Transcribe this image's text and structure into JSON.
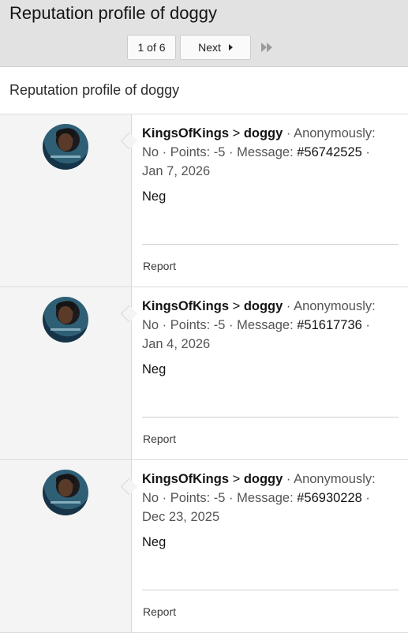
{
  "header": {
    "title": "Reputation profile of doggy"
  },
  "pager": {
    "count": "1 of 6",
    "next": "Next"
  },
  "section": {
    "title": "Reputation profile of doggy"
  },
  "entries": [
    {
      "from": "KingsOfKings",
      "sep": " > ",
      "to": "doggy",
      "anon_label": " · Anonymously: No · Points: -5 · Message: ",
      "message_id": "#56742525",
      "date": " · Jan 7, 2026",
      "body": "Neg",
      "report": "Report"
    },
    {
      "from": "KingsOfKings",
      "sep": " > ",
      "to": "doggy",
      "anon_label": " · Anonymously: No · Points: -5 · Message: ",
      "message_id": "#51617736",
      "date": " · Jan 4, 2026",
      "body": "Neg",
      "report": "Report"
    },
    {
      "from": "KingsOfKings",
      "sep": " > ",
      "to": "doggy",
      "anon_label": " · Anonymously: No · Points: -5 · Message: ",
      "message_id": "#56930228",
      "date": " · Dec 23, 2025",
      "body": "Neg",
      "report": "Report"
    }
  ]
}
